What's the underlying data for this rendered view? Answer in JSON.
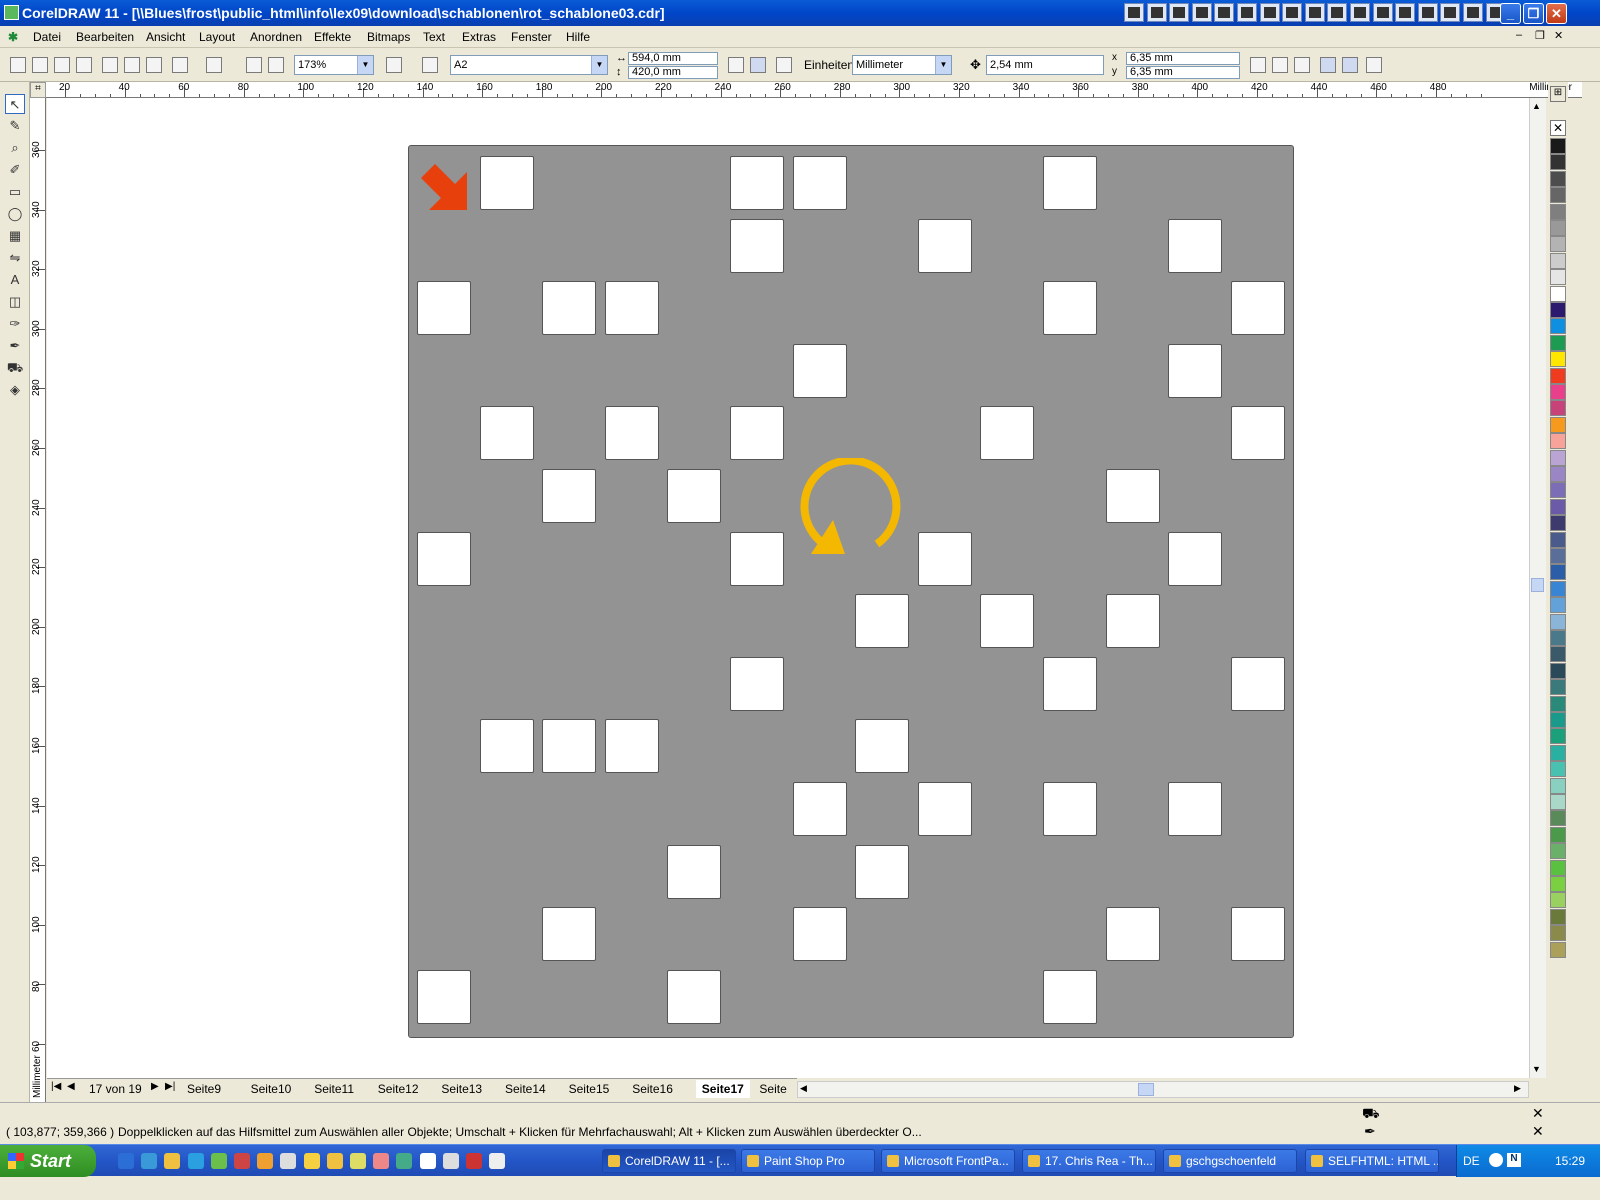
{
  "window": {
    "title": "CorelDRAW 11 - [\\\\Blues\\frost\\public_html\\info\\lex09\\download\\schablonen\\rot_schablone03.cdr]"
  },
  "menu": [
    "Datei",
    "Bearbeiten",
    "Ansicht",
    "Layout",
    "Anordnen",
    "Effekte",
    "Bitmaps",
    "Text",
    "Extras",
    "Fenster",
    "Hilfe"
  ],
  "toolbar": {
    "zoom": "173%",
    "paper_size": "A2",
    "width": "594,0 mm",
    "height": "420,0 mm",
    "units_label": "Einheiten:",
    "units": "Millimeter",
    "nudge": "2,54 mm",
    "dup_x": "6,35 mm",
    "dup_y": "6,35 mm"
  },
  "ruler": {
    "unit": "Millimeter",
    "h_labels": [
      "20",
      "40",
      "60",
      "80",
      "100",
      "120",
      "140",
      "160",
      "180",
      "200",
      "220",
      "240",
      "260",
      "280",
      "300",
      "320",
      "340",
      "360",
      "380",
      "400",
      "420",
      "440",
      "460",
      "480"
    ],
    "v_labels": [
      "360",
      "340",
      "320",
      "300",
      "280",
      "260",
      "240",
      "220",
      "200",
      "180",
      "160",
      "140",
      "120",
      "100",
      "80",
      "60"
    ]
  },
  "tools": [
    "pick-tool",
    "shape-tool",
    "zoom-tool",
    "freehand-tool",
    "rectangle-tool",
    "ellipse-tool",
    "graph-paper-tool",
    "interactive-blend-tool",
    "text-tool",
    "interactive-transparency-tool",
    "eyedropper-tool",
    "outline-tool",
    "fill-tool",
    "interactive-fill-tool"
  ],
  "template": {
    "cells": [
      [
        0,
        1
      ],
      [
        0,
        5
      ],
      [
        0,
        6
      ],
      [
        0,
        10
      ],
      [
        1,
        5
      ],
      [
        1,
        8
      ],
      [
        1,
        12
      ],
      [
        2,
        0
      ],
      [
        2,
        2
      ],
      [
        2,
        3
      ],
      [
        2,
        10
      ],
      [
        2,
        13
      ],
      [
        3,
        6
      ],
      [
        3,
        12
      ],
      [
        4,
        1
      ],
      [
        4,
        3
      ],
      [
        4,
        5
      ],
      [
        4,
        9
      ],
      [
        4,
        13
      ],
      [
        5,
        2
      ],
      [
        5,
        4
      ],
      [
        5,
        11
      ],
      [
        6,
        0
      ],
      [
        6,
        5
      ],
      [
        6,
        8
      ],
      [
        6,
        12
      ],
      [
        7,
        7
      ],
      [
        7,
        9
      ],
      [
        7,
        11
      ],
      [
        8,
        5
      ],
      [
        8,
        10
      ],
      [
        8,
        13
      ],
      [
        9,
        1
      ],
      [
        9,
        2
      ],
      [
        9,
        3
      ],
      [
        9,
        7
      ],
      [
        10,
        6
      ],
      [
        10,
        8
      ],
      [
        10,
        10
      ],
      [
        10,
        12
      ],
      [
        11,
        4
      ],
      [
        11,
        7
      ],
      [
        12,
        2
      ],
      [
        12,
        6
      ],
      [
        12,
        11
      ],
      [
        12,
        13
      ],
      [
        13,
        0
      ],
      [
        13,
        4
      ],
      [
        13,
        10
      ]
    ],
    "start_arrow_color": "#e8400c",
    "rotate_arrow_color": "#f5b800",
    "page_color": "#939393"
  },
  "pager": {
    "position": "17 von 19",
    "tabs": [
      "Seite9",
      "Seite10",
      "Seite11",
      "Seite12",
      "Seite13",
      "Seite14",
      "Seite15",
      "Seite16",
      "Seite17",
      "Seite"
    ],
    "active": "Seite17"
  },
  "status": {
    "coords": "( 103,877; 359,366 )",
    "hint": "Doppelklicken auf das Hilfsmittel zum Auswählen aller Objekte; Umschalt + Klicken für Mehrfachauswahl; Alt + Klicken zum Auswählen überdeckter O..."
  },
  "palette": [
    "#1a1a1a",
    "#333333",
    "#4d4d4d",
    "#666666",
    "#7f7f7f",
    "#999999",
    "#b3b3b3",
    "#cccccc",
    "#e5e5e5",
    "#ffffff",
    "#2b1a6e",
    "#0e8fe0",
    "#1e9b52",
    "#ffe600",
    "#ef3b1e",
    "#e8408a",
    "#c8427a",
    "#f59a1c",
    "#f7a39a",
    "#b9a4d4",
    "#9a86c4",
    "#7b6db6",
    "#6a5aa8",
    "#3d3a6e",
    "#4a5a8a",
    "#5a6e9a",
    "#2c5ea8",
    "#3a84d4",
    "#62a2d8",
    "#8ab4d8",
    "#4a7a8a",
    "#3a5a6a",
    "#2a4a5a",
    "#3a7a7a",
    "#2a8a7a",
    "#1a9a8a",
    "#1aa07a",
    "#2ab0a0",
    "#4ac0b0",
    "#8ad0c0",
    "#aad8c8",
    "#5a8a5a",
    "#4a9a4a",
    "#6ab06a",
    "#5ac040",
    "#7ad040",
    "#9ad060",
    "#6a7a3a",
    "#8a8a4a",
    "#aaa05a"
  ],
  "taskbar": {
    "start": "Start",
    "tasks": [
      "CorelDRAW 11 - [...",
      "Paint Shop Pro",
      "Microsoft FrontPa...",
      "17. Chris Rea - Th...",
      "gschgschoenfeld",
      "SELFHTML: HTML ..."
    ],
    "lang": "DE",
    "clock": "15:29"
  }
}
